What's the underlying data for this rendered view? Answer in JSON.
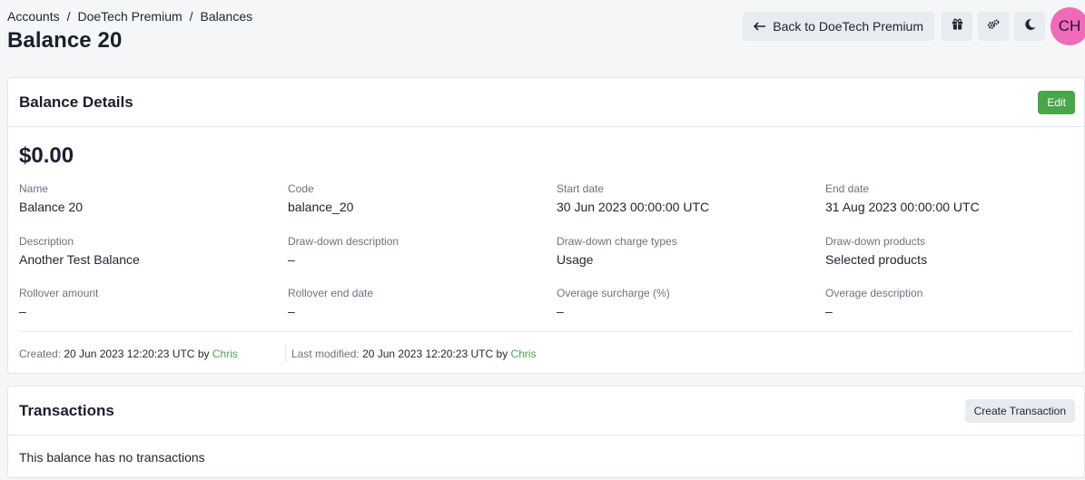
{
  "breadcrumb": {
    "items": [
      "Accounts",
      "DoeTech Premium",
      "Balances"
    ],
    "separator": "/"
  },
  "page_title": "Balance 20",
  "header_actions": {
    "back_label": "Back to DoeTech Premium",
    "avatar_initials": "CH",
    "icons": [
      "gift-icon",
      "settings-gears-icon",
      "moon-icon"
    ]
  },
  "balance_details": {
    "title": "Balance Details",
    "edit_label": "Edit",
    "amount": "$0.00",
    "fields": [
      {
        "label": "Name",
        "value": "Balance 20"
      },
      {
        "label": "Code",
        "value": "balance_20"
      },
      {
        "label": "Start date",
        "value": "30 Jun 2023 00:00:00 UTC"
      },
      {
        "label": "End date",
        "value": "31 Aug 2023 00:00:00 UTC"
      },
      {
        "label": "Description",
        "value": "Another Test Balance"
      },
      {
        "label": "Draw-down description",
        "value": "–"
      },
      {
        "label": "Draw-down charge types",
        "value": "Usage"
      },
      {
        "label": "Draw-down products",
        "value": "Selected products"
      },
      {
        "label": "Rollover amount",
        "value": "–"
      },
      {
        "label": "Rollover end date",
        "value": "–"
      },
      {
        "label": "Overage surcharge (%)",
        "value": "–"
      },
      {
        "label": "Overage description",
        "value": "–"
      }
    ],
    "created": {
      "label": "Created:",
      "value": "20 Jun 2023 12:20:23 UTC",
      "by": "by",
      "user": "Chris"
    },
    "modified": {
      "label": "Last modified:",
      "value": "20 Jun 2023 12:20:23 UTC",
      "by": "by",
      "user": "Chris"
    }
  },
  "transactions": {
    "title": "Transactions",
    "create_label": "Create Transaction",
    "empty_text": "This balance has no transactions"
  },
  "colors": {
    "accent_green": "#4aa64a",
    "avatar_pink": "#f06ab8",
    "background": "#f4f6f8"
  }
}
